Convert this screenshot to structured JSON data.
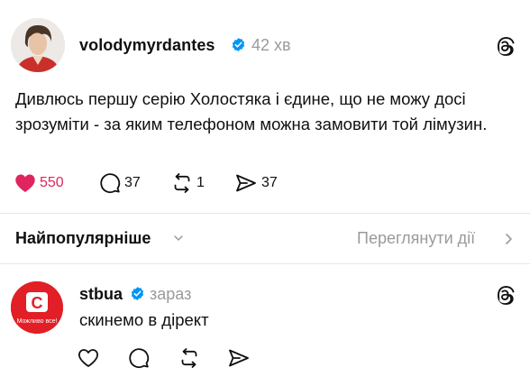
{
  "post": {
    "username": "volodymyrdantes",
    "time": "42 хв",
    "text": "Дивлюсь першу серію Холостяка і єдине, що не можу досі зрозуміти - за яким телефоном можна замовити той лімузин.",
    "likes": "550",
    "comments": "37",
    "reposts": "1",
    "shares": "37",
    "liked": true,
    "like_color": "#e0245e"
  },
  "sort": {
    "label": "Найпопулярніше",
    "view_activity": "Переглянути дії"
  },
  "reply": {
    "username": "stbua",
    "time": "зараз",
    "text": "скинемо в дірект",
    "avatar_logo_letter": "С",
    "avatar_caption": "Можливо все!",
    "avatar_color": "#e21f26"
  },
  "colors": {
    "verified": "#0095f6",
    "muted": "#9a9a9a"
  }
}
